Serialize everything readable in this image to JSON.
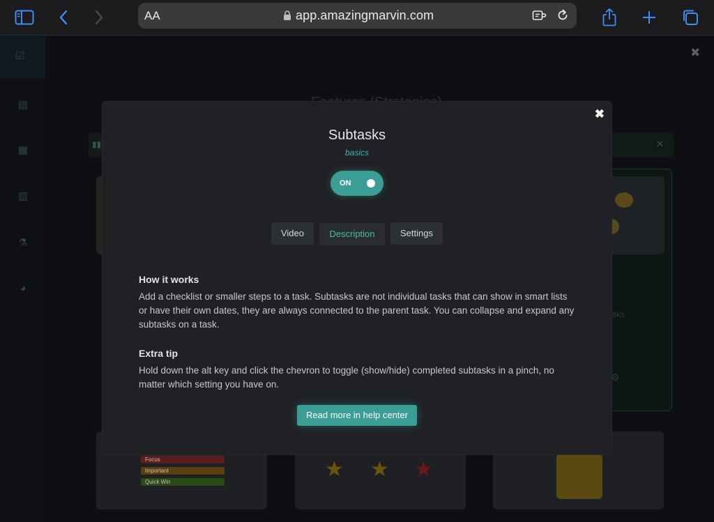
{
  "browser": {
    "text_size_label": "AA",
    "url": "app.amazingmarvin.com"
  },
  "background": {
    "title": "Features (Strategies)",
    "side_text": "sks.",
    "tags": [
      "Focus",
      "Important",
      "Quick Win"
    ]
  },
  "modal": {
    "title": "Subtasks",
    "category": "basics",
    "toggle_label": "ON",
    "toggle_on": true,
    "tabs": [
      {
        "label": "Video"
      },
      {
        "label": "Description",
        "active": true
      },
      {
        "label": "Settings"
      }
    ],
    "sections": [
      {
        "heading": "How it works",
        "body": "Add a checklist or smaller steps to a task. Subtasks are not individual tasks that can show in smart lists or have their own dates, they are always connected to the parent task. You can collapse and expand any subtasks on a task."
      },
      {
        "heading": "Extra tip",
        "body": "Hold down the alt key and click the chevron to toggle (show/hide) completed subtasks in a pinch, no matter which setting you have on."
      }
    ],
    "cta_label": "Read more in help center"
  },
  "colors": {
    "accent": "#3a9e97",
    "accent_text": "#3fb6ad",
    "safari_blue": "#3e8ef7"
  }
}
